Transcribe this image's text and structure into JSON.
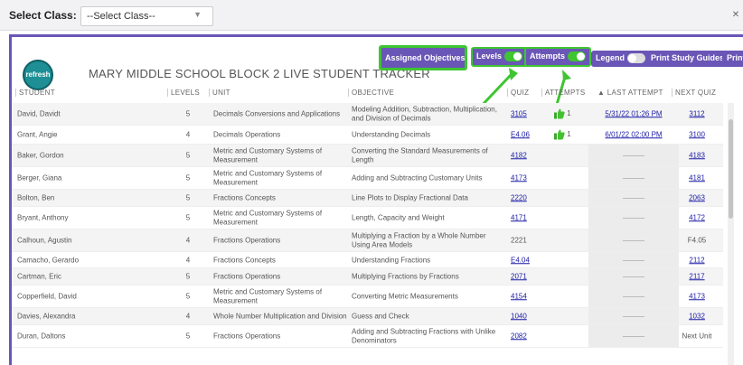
{
  "topbar": {
    "select_label": "Select Class:",
    "select_value": "--Select Class--",
    "close_icon": "close-icon"
  },
  "header": {
    "logo_text": "refresh",
    "title": "MARY  MIDDLE SCHOOL BLOCK 2 LIVE STUDENT TRACKER",
    "buttons": {
      "assigned": "Assigned Objectives",
      "levels": "Levels",
      "attempts": "Attempts",
      "legend": "Legend",
      "study": "Print Study Guides",
      "print": "Print"
    }
  },
  "colors": {
    "accent": "#6a56b6",
    "highlight": "#3ec531",
    "link": "#1a1aa6"
  },
  "columns": {
    "student": "Student",
    "levels": "Levels",
    "unit": "Unit",
    "objective": "Objective",
    "quiz": "Quiz",
    "attempts": "Attempts",
    "last": "Last attempt",
    "next": "Next quiz"
  },
  "rows": [
    {
      "student": "David, Davidt",
      "level": "5",
      "unit": "Decimals Conversions and Applications",
      "objective": "Modeling Addition, Subtraction, Multiplication, and Division of Decimals",
      "quiz": "3105",
      "attempts": "1",
      "last": "5/31/22 01:26 PM",
      "next": "3112"
    },
    {
      "student": "Grant, Angie",
      "level": "4",
      "unit": "Decimals Operations",
      "objective": "Understanding Decimals",
      "quiz": "E4.06",
      "attempts": "1",
      "last": "6/01/22 02:00 PM",
      "next": "3100"
    },
    {
      "student": "Baker, Gordon",
      "level": "5",
      "unit": "Metric and Customary Systems of Measurement",
      "objective": "Converting the Standard Measurements of Length",
      "quiz": "4182",
      "attempts": "",
      "last": "",
      "next": "4183"
    },
    {
      "student": "Berger, Giana",
      "level": "5",
      "unit": "Metric and Customary Systems of Measurement",
      "objective": "Adding and Subtracting Customary Units",
      "quiz": "4173",
      "attempts": "",
      "last": "",
      "next": "4181"
    },
    {
      "student": "Bolton, Ben",
      "level": "5",
      "unit": "Fractions Concepts",
      "objective": "Line Plots to Display Fractional Data",
      "quiz": "2220",
      "attempts": "",
      "last": "",
      "next": "2063"
    },
    {
      "student": "Bryant, Anthony",
      "level": "5",
      "unit": "Metric and Customary Systems of Measurement",
      "objective": "Length, Capacity and Weight",
      "quiz": "4171",
      "attempts": "",
      "last": "",
      "next": "4172"
    },
    {
      "student": "Calhoun, Agustin",
      "level": "4",
      "unit": "Fractions Operations",
      "objective": "Multiplying a Fraction by a Whole Number Using Area Models",
      "quiz": "2221",
      "attempts": "",
      "last": "",
      "next": "F4.05"
    },
    {
      "student": "Camacho, Gerardo",
      "level": "4",
      "unit": "Fractions Concepts",
      "objective": "Understanding Fractions",
      "quiz": "E4.04",
      "attempts": "",
      "last": "",
      "next": "2112"
    },
    {
      "student": "Cartman, Eric",
      "level": "5",
      "unit": "Fractions Operations",
      "objective": "Multiplying Fractions by Fractions",
      "quiz": "2071",
      "attempts": "",
      "last": "",
      "next": "2117"
    },
    {
      "student": "Copperfield, David",
      "level": "5",
      "unit": "Metric and Customary Systems of Measurement",
      "objective": "Converting Metric Measurements",
      "quiz": "4154",
      "attempts": "",
      "last": "",
      "next": "4173"
    },
    {
      "student": "Davies, Alexandra",
      "level": "4",
      "unit": "Whole Number Multiplication and Division",
      "objective": "Guess and Check",
      "quiz": "1040",
      "attempts": "",
      "last": "",
      "next": "1032"
    },
    {
      "student": "Duran, Daltons",
      "level": "5",
      "unit": "Fractions Operations",
      "objective": "Adding and Subtracting Fractions with Unlike Denominators",
      "quiz": "2082",
      "attempts": "",
      "last": "",
      "next": "Next Unit"
    }
  ]
}
